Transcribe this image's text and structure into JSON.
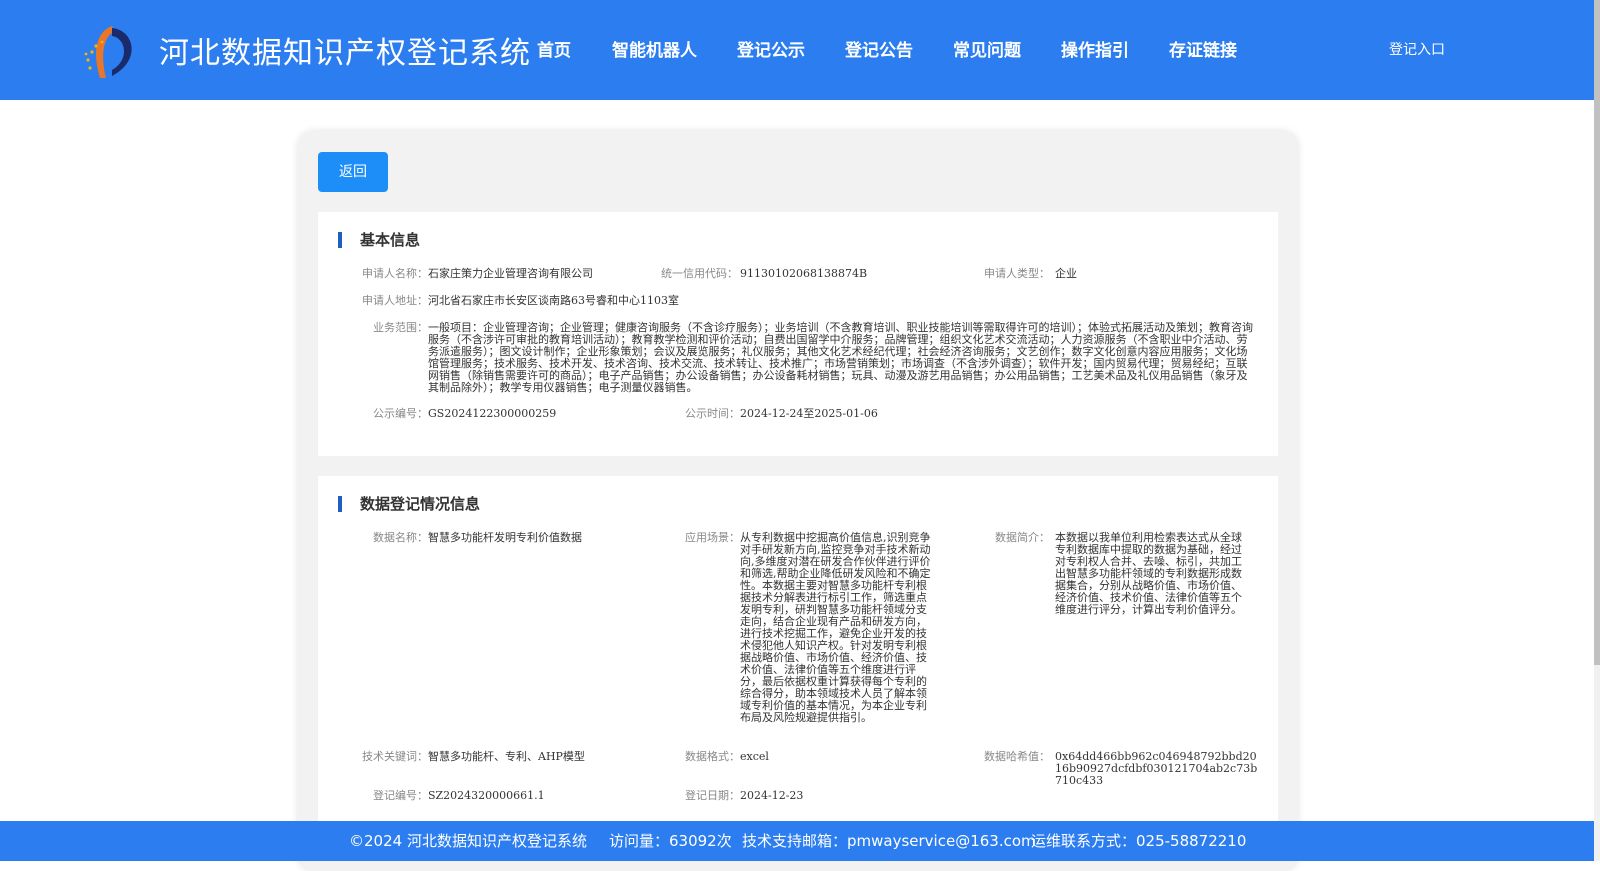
{
  "header": {
    "site_title": "河北数据知识产权登记系统",
    "nav": [
      "首页",
      "智能机器人",
      "登记公示",
      "登记公告",
      "常见问题",
      "操作指引",
      "存证链接"
    ],
    "login_label": "登记入口",
    "brand_color": "#2b7df0"
  },
  "back_button_label": "返回",
  "basic_info": {
    "title": "基本信息",
    "applicant_name_label": "申请人名称：",
    "applicant_name": "石家庄策力企业管理咨询有限公司",
    "credit_code_label": "统一信用代码：",
    "credit_code": "91130102068138874B",
    "applicant_type_label": "申请人类型：",
    "applicant_type": "企业",
    "address_label": "申请人地址：",
    "address": "河北省石家庄市长安区谈南路63号睿和中心1103室",
    "scope_label": "业务范围：",
    "scope": "一般项目：企业管理咨询；企业管理；健康咨询服务（不含诊疗服务）；业务培训（不含教育培训、职业技能培训等需取得许可的培训）；体验式拓展活动及策划；教育咨询服务（不含涉许可审批的教育培训活动）；教育教学检测和评价活动；自费出国留学中介服务；品牌管理；组织文化艺术交流活动；人力资源服务（不含职业中介活动、劳务派遣服务）；图文设计制作；企业形象策划；会议及展览服务；礼仪服务；其他文化艺术经纪代理；社会经济咨询服务；文艺创作；数字文化创意内容应用服务；文化场馆管理服务；技术服务、技术开发、技术咨询、技术交流、技术转让、技术推广；市场营销策划；市场调查（不含涉外调查）；软件开发；国内贸易代理；贸易经纪；互联网销售（除销售需要许可的商品）；电子产品销售；办公设备销售；办公设备耗材销售；玩具、动漫及游艺用品销售；办公用品销售；工艺美术品及礼仪用品销售（象牙及其制品除外）；教学专用仪器销售；电子测量仪器销售。",
    "notice_no_label": "公示编号：",
    "notice_no": "GS2024122300000259",
    "notice_time_label": "公示时间：",
    "notice_time": "2024-12-24至2025-01-06"
  },
  "data_info": {
    "title": "数据登记情况信息",
    "data_name_label": "数据名称：",
    "data_name": "智慧多功能杆发明专利价值数据",
    "scenario_label": "应用场景：",
    "scenario": "从专利数据中挖掘高价值信息,识别竞争对手研发新方向,监控竞争对手技术新动向,多维度对潜在研发合作伙伴进行评价和筛选,帮助企业降低研发风险和不确定性。本数据主要对智慧多功能杆专利根据技术分解表进行标引工作，筛选重点发明专利，研判智慧多功能杆领域分支走向，结合企业现有产品和研发方向，进行技术挖掘工作，避免企业开发的技术侵犯他人知识产权。针对发明专利根据战略价值、市场价值、经济价值、技术价值、法律价值等五个维度进行评分，最后依据权重计算获得每个专利的综合得分，助本领域技术人员了解本领域专利价值的基本情况，为本企业专利布局及风险规避提供指引。",
    "intro_label": "数据简介：",
    "intro": "本数据以我单位利用检索表达式从全球专利数据库中提取的数据为基础，经过对专利权人合并、去噪、标引，共加工出智慧多功能杆领域的专利数据形成数据集合，分别从战略价值、市场价值、经济价值、技术价值、法律价值等五个维度进行评分，计算出专利价值评分。",
    "keywords_label": "技术关键词：",
    "keywords": "智慧多功能杆、专利、AHP模型",
    "format_label": "数据格式：",
    "format": "excel",
    "hash_label": "数据哈希值：",
    "hash": "0x64dd466bb962c046948792bbd2016b90927dcfdbf030121704ab2c73b710c433",
    "reg_no_label": "登记编号：",
    "reg_no": "SZ2024320000661.1",
    "reg_date_label": "登记日期：",
    "reg_date": "2024-12-23"
  },
  "footer": {
    "copyright": "©2024 河北数据知识产权登记系统",
    "visits": "访问量：63092次",
    "support_email": "技术支持邮箱：pmwayservice@163.com",
    "ops_phone": "运维联系方式：025-58872210"
  }
}
